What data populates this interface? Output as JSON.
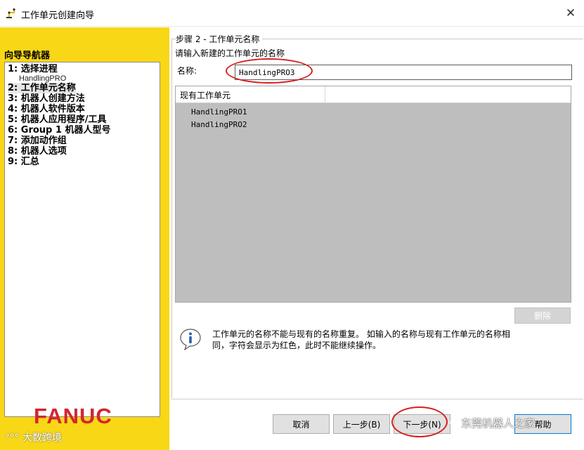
{
  "window": {
    "title": "工作单元创建向导",
    "close_glyph": "✕"
  },
  "nav": {
    "header": "向导导航器",
    "items": [
      {
        "label": "1: 选择进程",
        "sub": "HandlingPRO"
      },
      {
        "label": "2: 工作单元名称"
      },
      {
        "label": "3: 机器人创建方法"
      },
      {
        "label": "4: 机器人软件版本"
      },
      {
        "label": "5: 机器人应用程序/工具"
      },
      {
        "label": "6: Group 1 机器人型号"
      },
      {
        "label": "7: 添加动作组"
      },
      {
        "label": "8: 机器人选项"
      },
      {
        "label": "9: 汇总"
      }
    ],
    "logo_text": "FANUC"
  },
  "step": {
    "title": "步骤 2 - 工作单元名称",
    "prompt": "请输入新建的工作单元的名称",
    "name_label": "名称:",
    "name_value": "HandlingPRO3"
  },
  "cells": {
    "header": "现有工作单元",
    "rows": [
      "HandlingPRO1",
      "HandlingPRO2"
    ]
  },
  "delete_button": "删除",
  "info": {
    "line1": "工作单元的名称不能与现有的名称重复。   如输入的名称与现有工作单元的名称相",
    "line2": "同，字符会显示为红色，此时不能继续操作。"
  },
  "buttons": {
    "cancel": "取消",
    "back": "上一步(B)",
    "next": "下一步(N)",
    "help": "帮助"
  },
  "watermarks": {
    "main": "东莞机器人之家",
    "corner": "大数跨境"
  },
  "colors": {
    "nav_background": "#f8d716",
    "logo": "#d3262e",
    "annotation": "#d62020"
  }
}
